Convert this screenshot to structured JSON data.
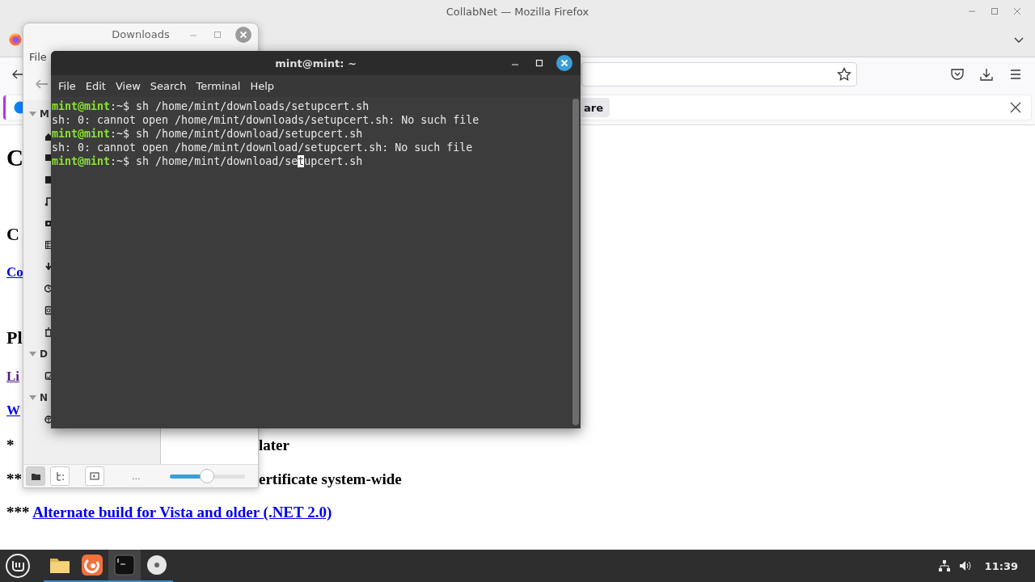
{
  "firefox": {
    "title": "CollabNet — Mozilla Firefox",
    "notification": {
      "button": "are"
    },
    "page": [
      {
        "kind": "h1",
        "text": "C"
      },
      {
        "kind": "h2",
        "text": "C"
      },
      {
        "kind": "link",
        "text": "Co",
        "visited": false
      },
      {
        "kind": "h2",
        "text": "Pl"
      },
      {
        "kind": "link",
        "text": "Li",
        "visited": true
      },
      {
        "kind": "link",
        "text": "W",
        "visited": false
      },
      {
        "kind": "note",
        "marker": "*",
        "tail": "later"
      },
      {
        "kind": "note",
        "marker": "**",
        "tail": "ertificate system-wide"
      },
      {
        "kind": "note_link",
        "marker": "***",
        "link": "Alternate build for Vista and older (.NET 2.0)",
        "visited": false
      }
    ]
  },
  "downloads": {
    "title": "Downloads",
    "menu": [
      "File"
    ],
    "sidebar": [
      {
        "label": "M",
        "expanded": true,
        "items": [
          {
            "kind": "home"
          },
          {
            "kind": "desktop"
          },
          {
            "kind": "documents"
          },
          {
            "kind": "music"
          },
          {
            "kind": "pictures"
          },
          {
            "kind": "videos"
          },
          {
            "kind": "downloads"
          },
          {
            "kind": "recent"
          },
          {
            "kind": "filesystem"
          },
          {
            "kind": "trash"
          }
        ]
      },
      {
        "label": "D",
        "expanded": true,
        "items": [
          {
            "kind": "drive"
          }
        ]
      },
      {
        "label": "N",
        "expanded": true,
        "items": [
          {
            "kind": "network"
          }
        ]
      }
    ],
    "status_bar": {
      "view_buttons": [
        {
          "kind": "places",
          "selected": true
        },
        {
          "kind": "tree",
          "selected": false
        }
      ],
      "more": "...",
      "zoom": {
        "level": 0.5
      }
    }
  },
  "terminal": {
    "title": "mint@mint: ~",
    "menu": [
      "File",
      "Edit",
      "View",
      "Search",
      "Terminal",
      "Help"
    ],
    "lines": [
      {
        "kind": "prompt",
        "user": "mint@mint",
        "dir": ":~$",
        "command": "sh /home/mint/downloads/setupcert.sh"
      },
      {
        "kind": "output",
        "text": "sh: 0: cannot open /home/mint/downloads/setupcert.sh: No such file"
      },
      {
        "kind": "prompt",
        "user": "mint@mint",
        "dir": ":~$",
        "command": "sh /home/mint/download/setupcert.sh"
      },
      {
        "kind": "output",
        "text": "sh: 0: cannot open /home/mint/download/setupcert.sh: No such file"
      },
      {
        "kind": "prompt",
        "user": "mint@mint",
        "dir": ":~$",
        "command": "sh /home/mint/download/se",
        "cursor": "t",
        "rest": "upcert.sh"
      }
    ]
  },
  "taskbar": {
    "apps": [
      {
        "kind": "files",
        "running": true,
        "selected": false
      },
      {
        "kind": "browser",
        "running": true,
        "selected": false
      },
      {
        "kind": "terminal",
        "running": true,
        "selected": true
      },
      {
        "kind": "disc",
        "running": true,
        "selected": false
      }
    ],
    "clock": "11:39"
  }
}
